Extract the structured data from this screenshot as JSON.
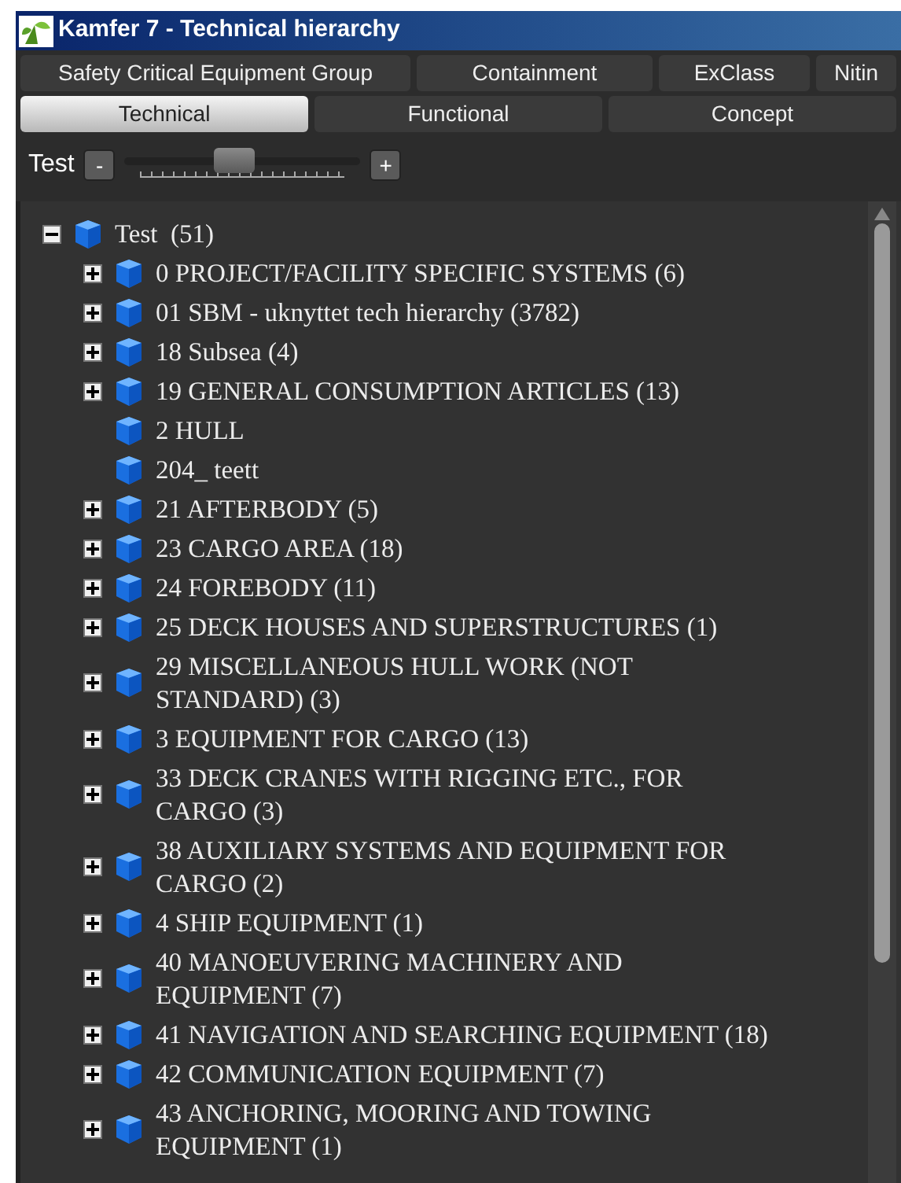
{
  "window": {
    "title": "Kamfer 7 - Technical hierarchy"
  },
  "tab_rows": [
    [
      {
        "label": "Safety Critical Equipment Group",
        "selected": false
      },
      {
        "label": "Containment",
        "selected": false
      },
      {
        "label": "ExClass",
        "selected": false
      },
      {
        "label": "Nitin",
        "selected": false
      }
    ],
    [
      {
        "label": "Technical",
        "selected": true
      },
      {
        "label": "Functional",
        "selected": false
      },
      {
        "label": "Concept",
        "selected": false
      }
    ]
  ],
  "zoom": {
    "label": "Test",
    "minus": "-",
    "plus": "+",
    "level": 0.46
  },
  "tree": {
    "root": {
      "label": "Test  (51)",
      "expanded": true,
      "children": [
        {
          "label": "0 PROJECT/FACILITY SPECIFIC SYSTEMS (6)",
          "kind": "branch",
          "expanded": false
        },
        {
          "label": "01 SBM - uknyttet tech hierarchy (3782)",
          "kind": "branch",
          "expanded": false
        },
        {
          "label": "18 Subsea (4)",
          "kind": "branch",
          "expanded": false
        },
        {
          "label": "19 GENERAL CONSUMPTION ARTICLES (13)",
          "kind": "branch",
          "expanded": false
        },
        {
          "label": "2 HULL",
          "kind": "leaf"
        },
        {
          "label": "204_ teett",
          "kind": "leaf"
        },
        {
          "label": "21 AFTERBODY (5)",
          "kind": "branch",
          "expanded": false
        },
        {
          "label": "23 CARGO AREA (18)",
          "kind": "branch",
          "expanded": false
        },
        {
          "label": "24 FOREBODY (11)",
          "kind": "branch",
          "expanded": false
        },
        {
          "label": "25 DECK HOUSES AND SUPERSTRUCTURES (1)",
          "kind": "branch",
          "expanded": false
        },
        {
          "label": "29 MISCELLANEOUS HULL WORK (NOT STANDARD) (3)",
          "kind": "branch",
          "expanded": false
        },
        {
          "label": "3 EQUIPMENT FOR CARGO (13)",
          "kind": "branch",
          "expanded": false
        },
        {
          "label": "33 DECK CRANES WITH RIGGING ETC., FOR CARGO (3)",
          "kind": "branch",
          "expanded": false
        },
        {
          "label": "38 AUXILIARY SYSTEMS AND EQUIPMENT FOR CARGO (2)",
          "kind": "branch",
          "expanded": false
        },
        {
          "label": "4 SHIP EQUIPMENT (1)",
          "kind": "branch",
          "expanded": false
        },
        {
          "label": "40 MANOEUVERING MACHINERY AND EQUIPMENT (7)",
          "kind": "branch",
          "expanded": false
        },
        {
          "label": "41 NAVIGATION AND SEARCHING EQUIPMENT (18)",
          "kind": "branch",
          "expanded": false
        },
        {
          "label": "42 COMMUNICATION EQUIPMENT (7)",
          "kind": "branch",
          "expanded": false
        },
        {
          "label": "43 ANCHORING, MOORING AND TOWING EQUIPMENT (1)",
          "kind": "branch",
          "expanded": false
        }
      ]
    }
  }
}
